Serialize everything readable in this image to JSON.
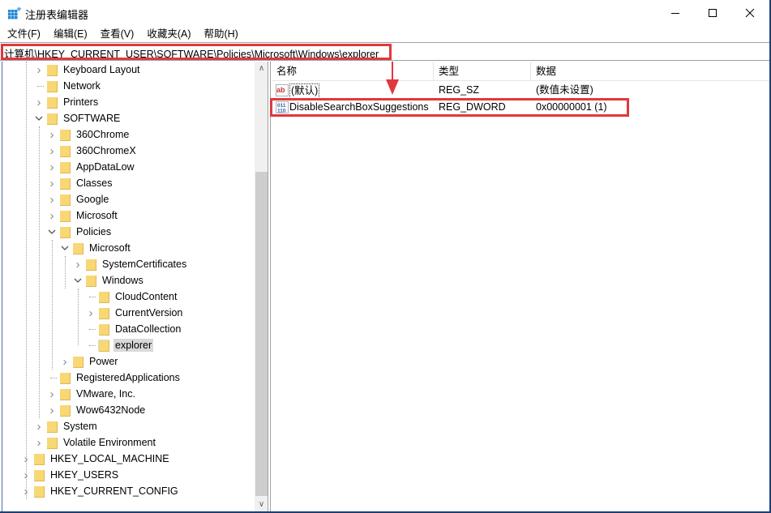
{
  "window": {
    "title": "注册表编辑器",
    "app_icon": "registry-editor-icon",
    "controls": {
      "minimize": "minimize-icon",
      "maximize": "maximize-icon",
      "close": "close-icon"
    }
  },
  "menubar": {
    "items": [
      {
        "label": "文件(F)"
      },
      {
        "label": "编辑(E)"
      },
      {
        "label": "查看(V)"
      },
      {
        "label": "收藏夹(A)"
      },
      {
        "label": "帮助(H)"
      }
    ]
  },
  "address": {
    "path": "计算机\\HKEY_CURRENT_USER\\SOFTWARE\\Policies\\Microsoft\\Windows\\explorer",
    "highlight_color": "#e0383e"
  },
  "tree": {
    "items": [
      {
        "label": "Keyboard Layout",
        "level": 1,
        "expander": "collapsed"
      },
      {
        "label": "Network",
        "level": 1,
        "expander": "none"
      },
      {
        "label": "Printers",
        "level": 1,
        "expander": "collapsed"
      },
      {
        "label": "SOFTWARE",
        "level": 1,
        "expander": "expanded"
      },
      {
        "label": "360Chrome",
        "level": 2,
        "expander": "collapsed"
      },
      {
        "label": "360ChromeX",
        "level": 2,
        "expander": "collapsed"
      },
      {
        "label": "AppDataLow",
        "level": 2,
        "expander": "collapsed"
      },
      {
        "label": "Classes",
        "level": 2,
        "expander": "collapsed"
      },
      {
        "label": "Google",
        "level": 2,
        "expander": "collapsed"
      },
      {
        "label": "Microsoft",
        "level": 2,
        "expander": "collapsed"
      },
      {
        "label": "Policies",
        "level": 2,
        "expander": "expanded"
      },
      {
        "label": "Microsoft",
        "level": 3,
        "expander": "expanded"
      },
      {
        "label": "SystemCertificates",
        "level": 4,
        "expander": "collapsed"
      },
      {
        "label": "Windows",
        "level": 4,
        "expander": "expanded"
      },
      {
        "label": "CloudContent",
        "level": 5,
        "expander": "none"
      },
      {
        "label": "CurrentVersion",
        "level": 5,
        "expander": "collapsed"
      },
      {
        "label": "DataCollection",
        "level": 5,
        "expander": "none"
      },
      {
        "label": "explorer",
        "level": 5,
        "expander": "none",
        "selected": true
      },
      {
        "label": "Power",
        "level": 3,
        "expander": "collapsed"
      },
      {
        "label": "RegisteredApplications",
        "level": 2,
        "expander": "none"
      },
      {
        "label": "VMware, Inc.",
        "level": 2,
        "expander": "collapsed"
      },
      {
        "label": "Wow6432Node",
        "level": 2,
        "expander": "collapsed"
      },
      {
        "label": "System",
        "level": 1,
        "expander": "collapsed"
      },
      {
        "label": "Volatile Environment",
        "level": 1,
        "expander": "collapsed"
      },
      {
        "label": "HKEY_LOCAL_MACHINE",
        "level": 0,
        "expander": "collapsed"
      },
      {
        "label": "HKEY_USERS",
        "level": 0,
        "expander": "collapsed"
      },
      {
        "label": "HKEY_CURRENT_CONFIG",
        "level": 0,
        "expander": "collapsed"
      }
    ]
  },
  "list": {
    "columns": {
      "name": "名称",
      "type": "类型",
      "data": "数据"
    },
    "rows": [
      {
        "icon": "string-value-icon",
        "name": "(默认)",
        "type": "REG_SZ",
        "data": "(数值未设置)"
      },
      {
        "icon": "binary-value-icon",
        "name": "DisableSearchBoxSuggestions",
        "type": "REG_DWORD",
        "data": "0x00000001 (1)",
        "highlighted": true
      }
    ]
  },
  "annotation": {
    "arrow_color": "#e0383e",
    "box_color": "#e0383e"
  }
}
